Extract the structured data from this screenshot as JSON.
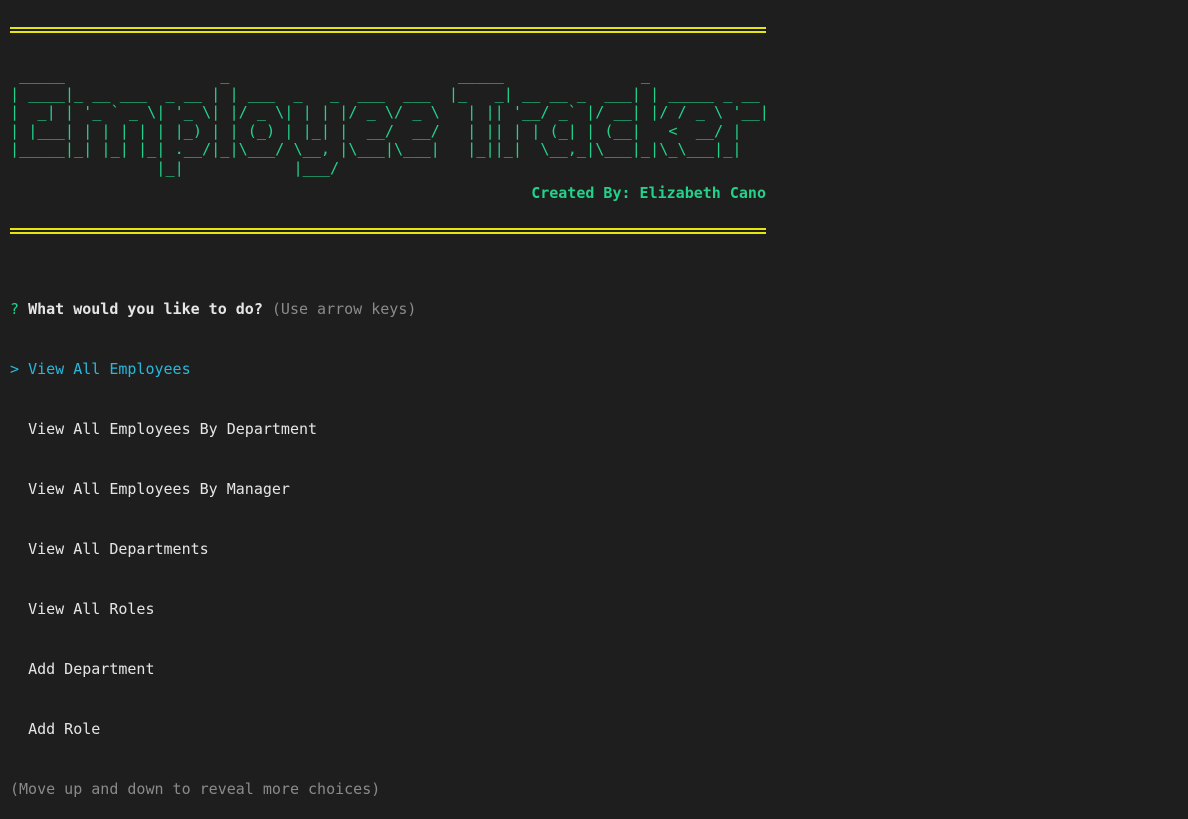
{
  "colors": {
    "background": "#1e1e1e",
    "rule": "#e5e510",
    "banner": "#23d18b",
    "selected": "#29b8db",
    "hint": "#8a8a8a"
  },
  "header": {
    "rule": "==========================================================================================",
    "banner_art": " _____                 _                         _____               _             \n| ____|_ __ ___  _ __ | | ___  _   _  ___  ___  |_   _| __ __ _  ___| | _____ _ __ \n|  _| | '_ ` _ \\| '_ \\| |/ _ \\| | | |/ _ \\/ _ \\   | || '__/ _` |/ __| |/ / _ \\ '__|\n| |___| | | | | | |_) | | (_) | |_| |  __/  __/   | || | | (_| | (__|   <  __/ |   \n|_____|_| |_| |_| .__/|_|\\___/ \\__, |\\___|\\___|   |_||_|  \\__,_|\\___|_|\\_\\___|_|   \n                |_|            |___/                                              ",
    "credit": "Created By: Elizabeth Cano"
  },
  "prompt": {
    "qmark": "?",
    "question": "What would you like to do?",
    "hint": "(Use arrow keys)",
    "pointer": ">",
    "choices": [
      "View All Employees",
      "View All Employees By Department",
      "View All Employees By Manager",
      "View All Departments",
      "View All Roles",
      "Add Department",
      "Add Role"
    ],
    "footer": "(Move up and down to reveal more choices)"
  }
}
